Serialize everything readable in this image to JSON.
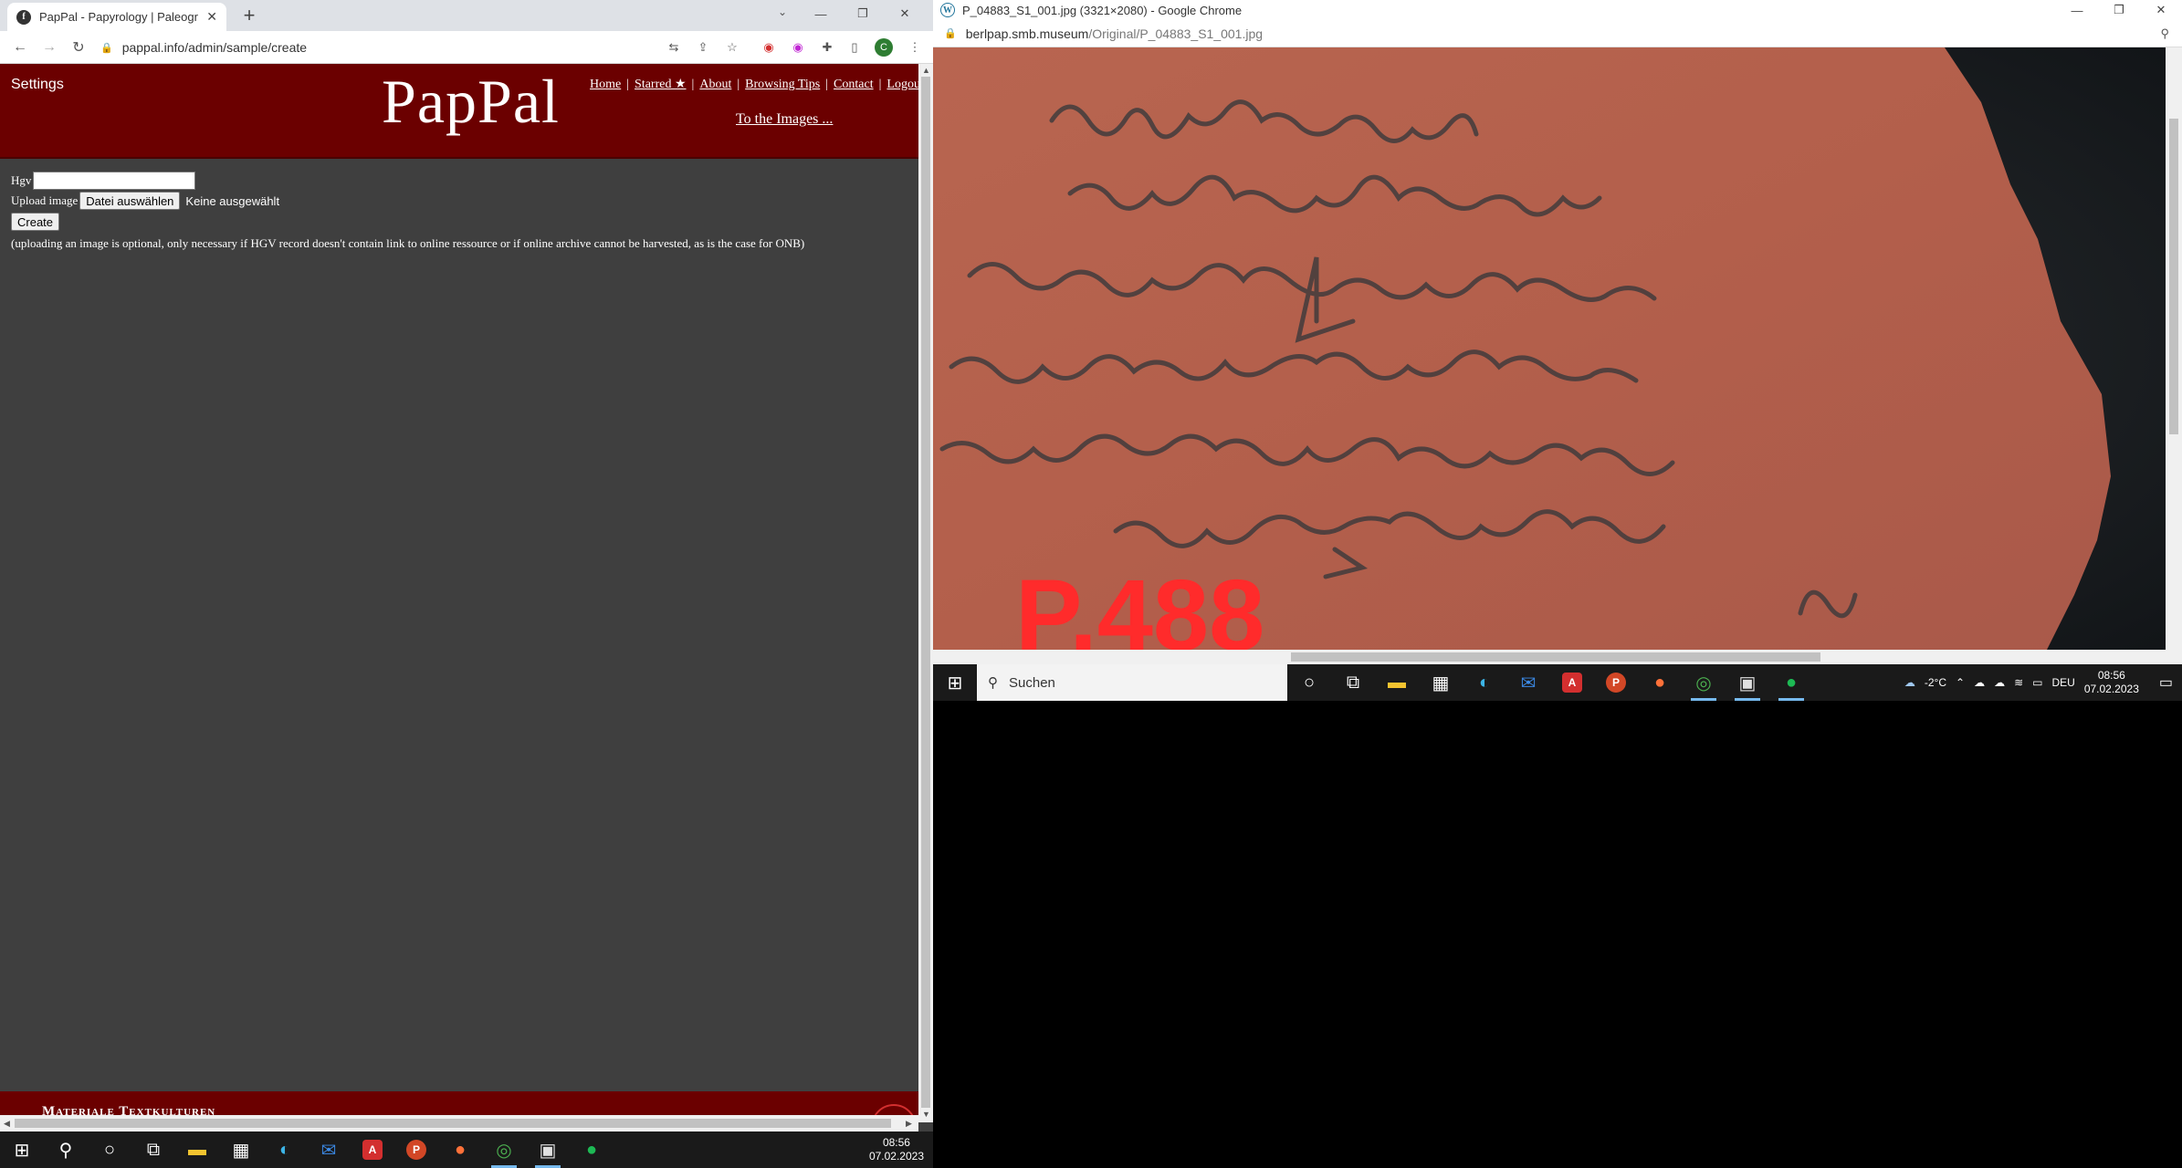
{
  "left_window": {
    "tab_title": "PapPal - Papyrology | Paleograph",
    "tab_favicon": "f",
    "url": "pappal.info/admin/sample/create",
    "avatar_letter": "C",
    "header": {
      "settings": "Settings",
      "logo": "PapPal",
      "nav": [
        {
          "label": "Home"
        },
        {
          "label": "Starred ★"
        },
        {
          "label": "About"
        },
        {
          "label": "Browsing Tips"
        },
        {
          "label": "Contact"
        },
        {
          "label": "Logout"
        }
      ],
      "to_images": "To the Images ..."
    },
    "form": {
      "hgv_label": "Hgv",
      "hgv_value": "",
      "upload_label": "Upload image",
      "file_button": "Datei auswählen",
      "file_status": "Keine ausgewählt",
      "create_button": "Create",
      "note": "(uploading an image is optional, only necessary if HGV record doesn't contain link to online ressource or if online archive cannot be harvested, as is the case for ONB)"
    },
    "footer": {
      "brand": "Materiale Textkulturen"
    }
  },
  "right_window": {
    "title": "P_04883_S1_001.jpg (3321×2080) - Google Chrome",
    "url_host": "berlpap.smb.museum",
    "url_path": "/Original/P_04883_S1_001.jpg",
    "image_label_fragment": "P.488",
    "colors": {
      "ostracon": "#b8644f",
      "ink": "#3d3a3c",
      "label": "#ff2b2b",
      "backdrop": "#181c1f"
    }
  },
  "taskbar_right": {
    "search_placeholder": "Suchen",
    "weather": "-2°C",
    "language": "DEU",
    "time": "08:56",
    "date": "07.02.2023"
  },
  "taskbar_left": {
    "time": "08:56",
    "date": "07.02.2023"
  },
  "accent": {
    "pappal_red": "#6b0000",
    "page_bg": "#3f3f3f"
  }
}
